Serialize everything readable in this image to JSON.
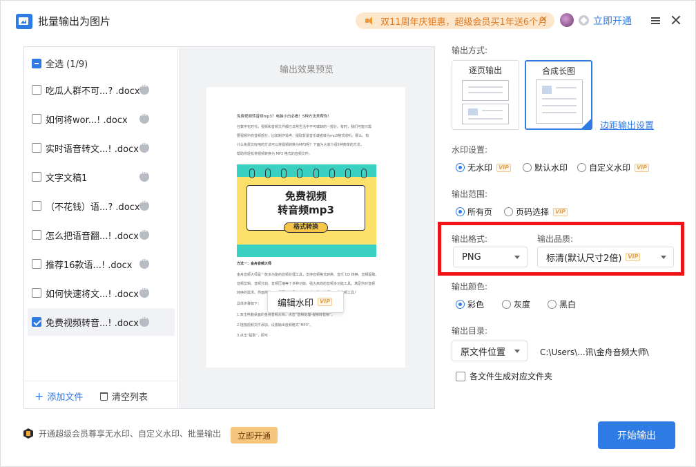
{
  "titlebar": {
    "title": "批量输出为图片",
    "promo_text": "双11周年庆钜惠，超级会员买1年送6个月",
    "open_vip": "立即开通"
  },
  "file_list": {
    "select_all": "全选 (1/9)",
    "items": [
      {
        "name": "吃瓜人群不可...?  .docx",
        "checked": false
      },
      {
        "name": "如何将wor...!  .docx",
        "checked": false
      },
      {
        "name": "实时语音转文...!  .docx",
        "checked": false
      },
      {
        "name": "文字文稿1",
        "checked": false
      },
      {
        "name": "（不花钱）语...?  .docx",
        "checked": false
      },
      {
        "name": "怎么把语音翻...!  .docx",
        "checked": false
      },
      {
        "name": "推荐16款语...!  .docx",
        "checked": false
      },
      {
        "name": "如何快速将文...!  .docx",
        "checked": false
      },
      {
        "name": "免费视频转音...!  .docx",
        "checked": true
      }
    ],
    "add_file": "添加文件",
    "clear_list": "清空列表"
  },
  "preview": {
    "title": "输出效果预览",
    "doc_lines": [
      "免费视频转音频mp3？电脑小白必看！5种方法来帮你！",
      "在数字化时代，视频和音频文件都已日常生活中不可或缺的一部分。有时，我们可能只需",
      "要视频中的音频部分，比如制作铃声、提取背景音乐或者转为mp3格式收听。那么，有",
      "什么免费又好用的方法可以将视频转换为MP3呢？下面为大家介绍5种简单的方法，",
      "帮助你轻松将视频转换为 MP3 格式的音频文件。"
    ],
    "poster_title_line1": "免费视频",
    "poster_title_line2": "转音频mp3",
    "poster_badge": "格式转换",
    "doc_lines_after": [
      "方法一：金舟音频大师",
      "金舟音频大师是一款多功能的音频处理工具，支持音频格式转换、音乐 CD 转换、音频提取、",
      "音频剪辑、音频分割、音频压缩等十多种功能。强大高效的音频多功能工具，满足你对音频",
      "转换的需求。界面简洁，只需要简单几步就可完成，是一款很好用的音频工具！",
      "具体步骤如下：",
      "1.双击电脑桌面的金舟音频大师，点击“音频处理-视频转音频”。",
      "2.拖拽视频文件添加，设置输出音频格式“MP3”。",
      "3.点击“提取”，即可"
    ],
    "edit_watermark": "编辑水印"
  },
  "settings": {
    "output_mode_label": "输出方式:",
    "mode_page": "逐页输出",
    "mode_long": "合成长图",
    "margin_setting": "边距输出设置",
    "watermark_label": "水印设置:",
    "watermark_options": [
      "无水印",
      "默认水印",
      "自定义水印"
    ],
    "range_label": "输出范围:",
    "range_options": [
      "所有页",
      "页码选择"
    ],
    "format_label": "输出格式:",
    "format_value": "PNG",
    "quality_label": "输出品质:",
    "quality_value": "标清(默认尺寸2倍)",
    "color_label": "输出颜色:",
    "color_options": [
      "彩色",
      "灰度",
      "黑白"
    ],
    "dir_label": "输出目录:",
    "dir_value": "原文件位置",
    "dir_path": "C:\\Users\\...讯\\金舟音频大师\\",
    "subfolder": "各文件生成对应文件夹",
    "vip_tag": "VIP"
  },
  "footer": {
    "tip": "开通超级会员尊享无水印、自定义水印、批量输出",
    "open_btn": "立即开通",
    "start_btn": "开始输出"
  },
  "colors": {
    "accent": "#2f7be6",
    "highlight_border": "#f01414",
    "promo_bg": "#fde7cc"
  }
}
